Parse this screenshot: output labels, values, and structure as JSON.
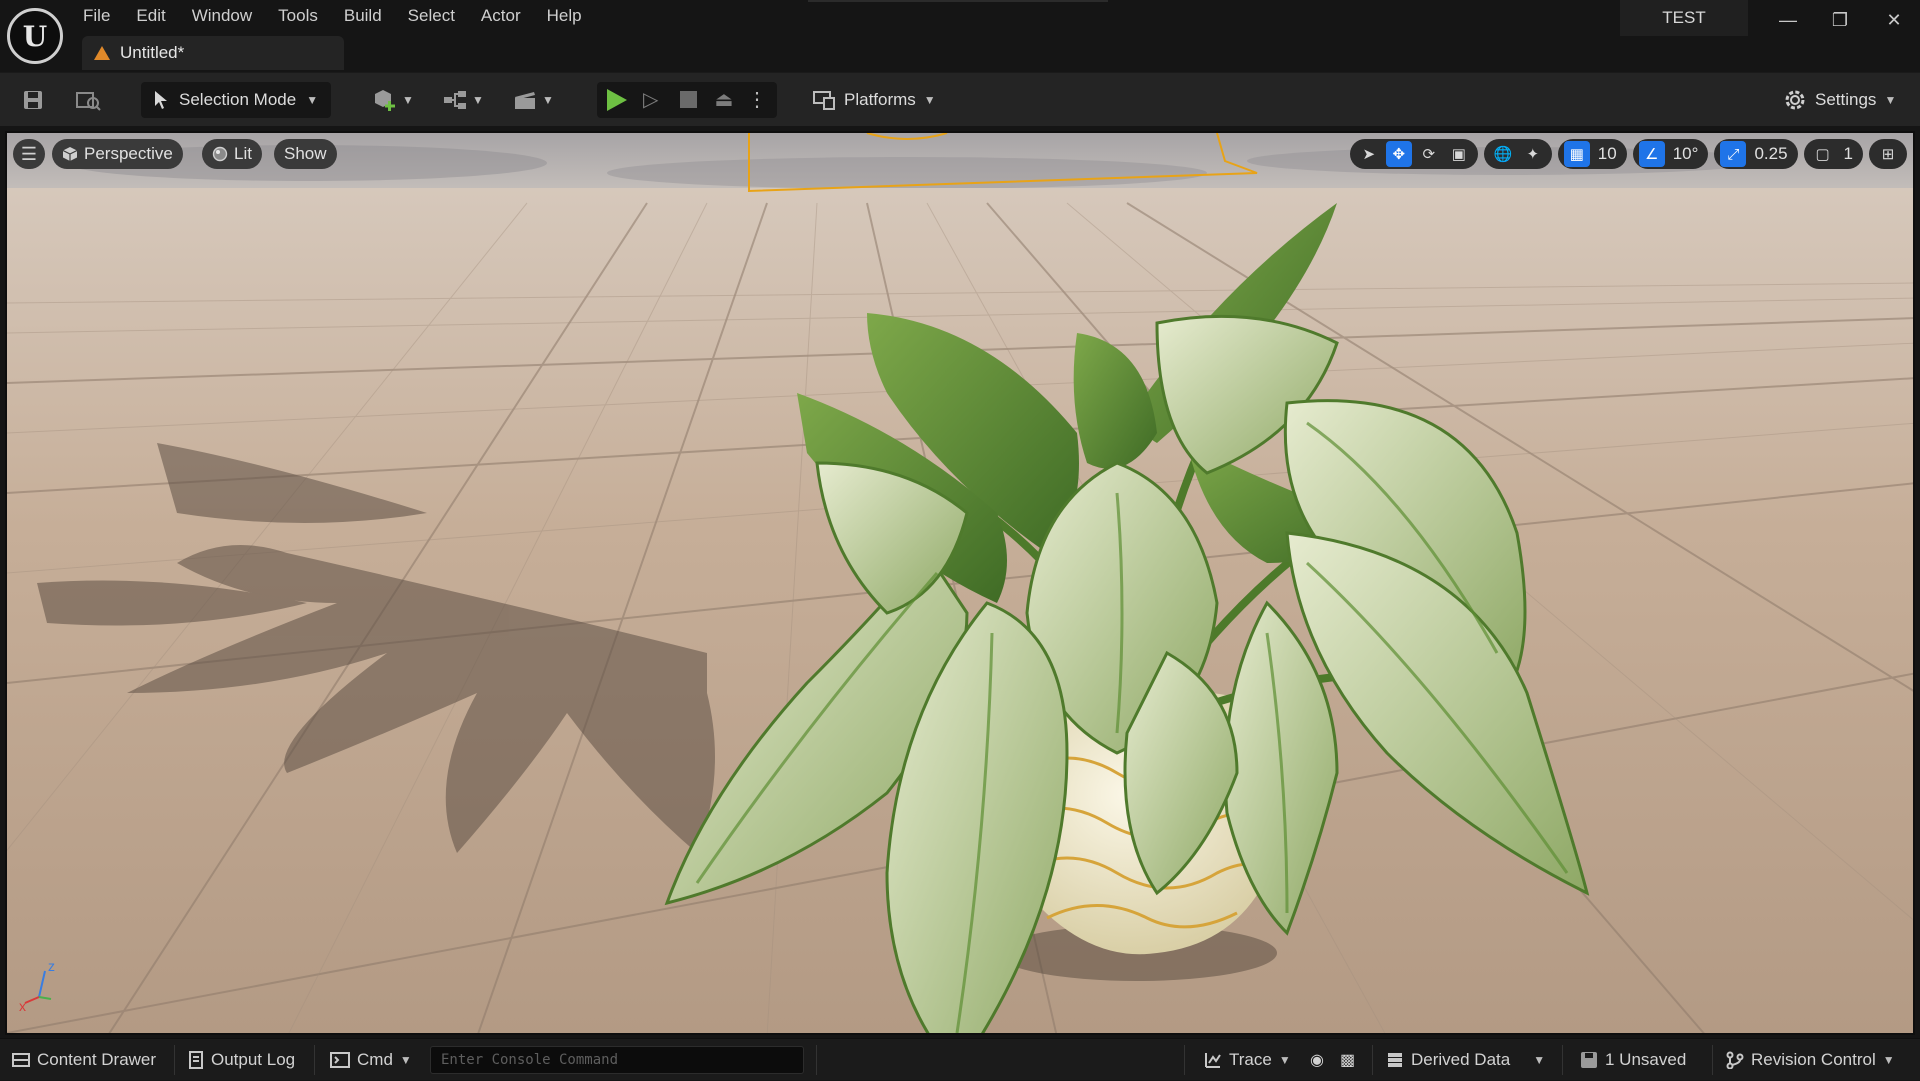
{
  "menu": {
    "items": [
      "File",
      "Edit",
      "Window",
      "Tools",
      "Build",
      "Select",
      "Actor",
      "Help"
    ]
  },
  "document_tab": {
    "label": "Untitled*"
  },
  "project": {
    "name": "TEST"
  },
  "toolbar": {
    "selection_mode_label": "Selection Mode",
    "platforms_label": "Platforms",
    "settings_label": "Settings"
  },
  "viewport": {
    "perspective_label": "Perspective",
    "lit_label": "Lit",
    "show_label": "Show",
    "grid_snap": "10",
    "rotation_snap": "10°",
    "scale_snap": "0.25",
    "camera_speed": "1",
    "axis_x": "x",
    "axis_z": "z"
  },
  "statusbar": {
    "content_drawer": "Content Drawer",
    "output_log": "Output Log",
    "cmd_label": "Cmd",
    "console_placeholder": "Enter Console Command",
    "trace_label": "Trace",
    "derived_data_label": "Derived Data",
    "unsaved_label": "1 Unsaved",
    "revision_control_label": "Revision Control"
  },
  "colors": {
    "play_green": "#6ec043",
    "active_blue": "#1f74e8",
    "unsaved_warning": "#e0892a",
    "floor_tile": "#c4ad96",
    "selection_outline": "#e8a317"
  },
  "icons": [
    "unreal-logo-icon",
    "warning-icon",
    "save-icon",
    "browse-icon",
    "cursor-icon",
    "add-actor-icon",
    "blueprint-icon",
    "cinematics-icon",
    "play-icon",
    "step-icon",
    "stop-icon",
    "eject-icon",
    "more-icon",
    "platforms-icon",
    "gear-icon",
    "hamburger-icon",
    "cube-icon",
    "lit-sphere-icon",
    "select-icon",
    "translate-icon",
    "rotate-icon",
    "scale-icon",
    "world-icon",
    "surface-snap-icon",
    "grid-icon",
    "angle-icon",
    "scale-snap-icon",
    "camera-icon",
    "layout-icon",
    "drawer-icon",
    "log-icon",
    "terminal-icon",
    "trace-icon",
    "derived-data-icon",
    "revision-control-icon"
  ]
}
